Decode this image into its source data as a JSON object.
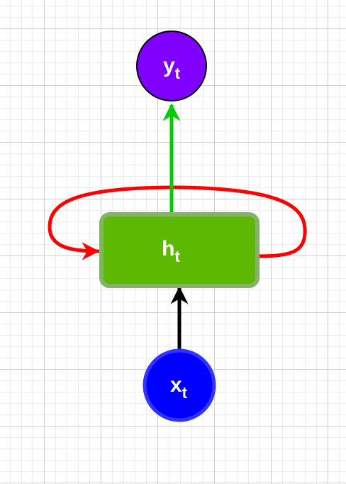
{
  "nodes": {
    "output": {
      "label": "y",
      "subscript": "t",
      "fill": "#7f00ff",
      "stroke": "#000000"
    },
    "hidden": {
      "label": "h",
      "subscript": "t",
      "fill": "#5cb800",
      "stroke": "#82b366"
    },
    "input": {
      "label": "x",
      "subscript": "t",
      "fill": "#0000ff",
      "stroke": "#3333ff"
    }
  },
  "edges": {
    "hidden_to_output": {
      "color": "#00cc00"
    },
    "input_to_hidden": {
      "color": "#000000"
    },
    "recurrent_loop": {
      "color": "#ff0000"
    }
  }
}
